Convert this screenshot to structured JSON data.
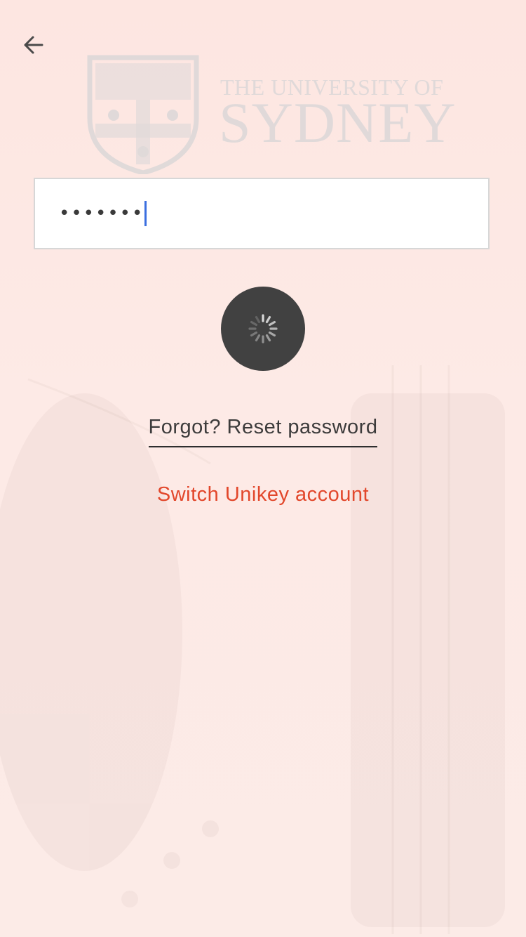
{
  "logo": {
    "text_top": "THE UNIVERSITY OF",
    "text_main": "SYDNEY"
  },
  "login": {
    "password_masked": "•••••••",
    "reset_link_label": "Forgot? Reset password",
    "switch_account_label": "Switch Unikey account"
  },
  "icons": {
    "back": "arrow-left-icon",
    "submit": "loading-spinner-icon"
  },
  "colors": {
    "background": "#fde6e1",
    "accent": "#e2472b",
    "caret": "#3b6fe0",
    "button": "#414141"
  }
}
